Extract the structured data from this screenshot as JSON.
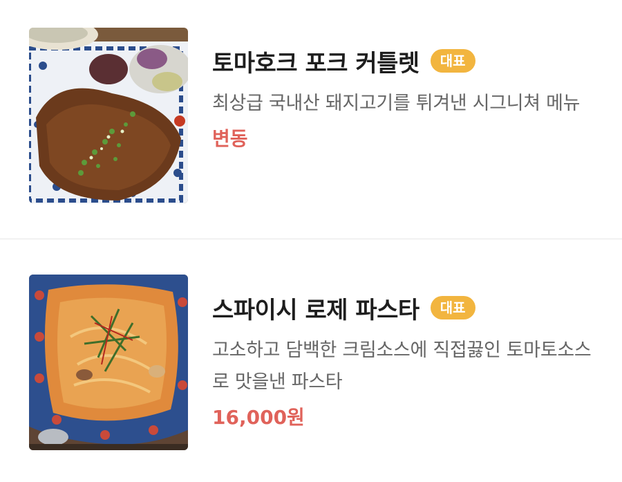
{
  "menu": {
    "items": [
      {
        "name": "토마호크 포크 커틀렛",
        "badge": "대표",
        "description": "최상급 국내산 돼지고기를 튀겨낸 시그니쳐 메뉴",
        "price": "변동",
        "image_icon": "pork-cutlet-photo"
      },
      {
        "name": "스파이시 로제 파스타",
        "badge": "대표",
        "description": "고소하고 담백한 크림소스에 직접끓인 토마토소스로 맛을낸 파스타",
        "price": "16,000원",
        "image_icon": "rose-pasta-photo"
      }
    ]
  },
  "colors": {
    "badge": "#f2b53f",
    "price": "#e0625a",
    "divider": "#e6e6e6"
  }
}
